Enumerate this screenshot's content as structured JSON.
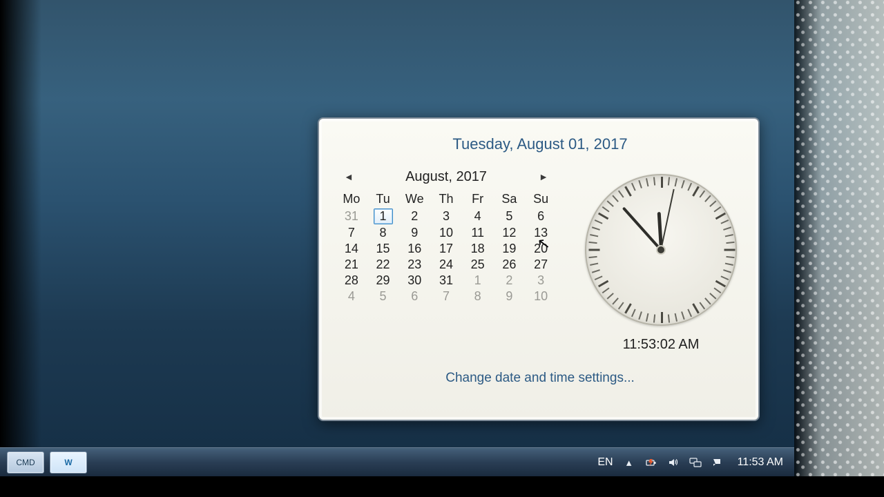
{
  "header": {
    "date_long": "Tuesday, August 01, 2017"
  },
  "calendar": {
    "month_label": "August, 2017",
    "prev_glyph": "◄",
    "next_glyph": "►",
    "day_headers": [
      "Mo",
      "Tu",
      "We",
      "Th",
      "Fr",
      "Sa",
      "Su"
    ],
    "weeks": [
      [
        {
          "d": "31",
          "dim": true
        },
        {
          "d": "1",
          "today": true
        },
        {
          "d": "2"
        },
        {
          "d": "3"
        },
        {
          "d": "4"
        },
        {
          "d": "5"
        },
        {
          "d": "6"
        }
      ],
      [
        {
          "d": "7"
        },
        {
          "d": "8"
        },
        {
          "d": "9"
        },
        {
          "d": "10"
        },
        {
          "d": "11"
        },
        {
          "d": "12"
        },
        {
          "d": "13"
        }
      ],
      [
        {
          "d": "14"
        },
        {
          "d": "15"
        },
        {
          "d": "16"
        },
        {
          "d": "17"
        },
        {
          "d": "18"
        },
        {
          "d": "19"
        },
        {
          "d": "20"
        }
      ],
      [
        {
          "d": "21"
        },
        {
          "d": "22"
        },
        {
          "d": "23"
        },
        {
          "d": "24"
        },
        {
          "d": "25"
        },
        {
          "d": "26"
        },
        {
          "d": "27"
        }
      ],
      [
        {
          "d": "28"
        },
        {
          "d": "29"
        },
        {
          "d": "30"
        },
        {
          "d": "31"
        },
        {
          "d": "1",
          "dim": true
        },
        {
          "d": "2",
          "dim": true
        },
        {
          "d": "3",
          "dim": true
        }
      ],
      [
        {
          "d": "4",
          "dim": true
        },
        {
          "d": "5",
          "dim": true
        },
        {
          "d": "6",
          "dim": true
        },
        {
          "d": "7",
          "dim": true
        },
        {
          "d": "8",
          "dim": true
        },
        {
          "d": "9",
          "dim": true
        },
        {
          "d": "10",
          "dim": true
        }
      ]
    ]
  },
  "clock": {
    "digital": "11:53:02 AM",
    "hours": 11,
    "minutes": 53,
    "seconds": 2
  },
  "link": {
    "change_settings": "Change date and time settings..."
  },
  "taskbar": {
    "lang": "EN",
    "time": "11:53 AM",
    "app1": "CMD",
    "app2": "W"
  }
}
